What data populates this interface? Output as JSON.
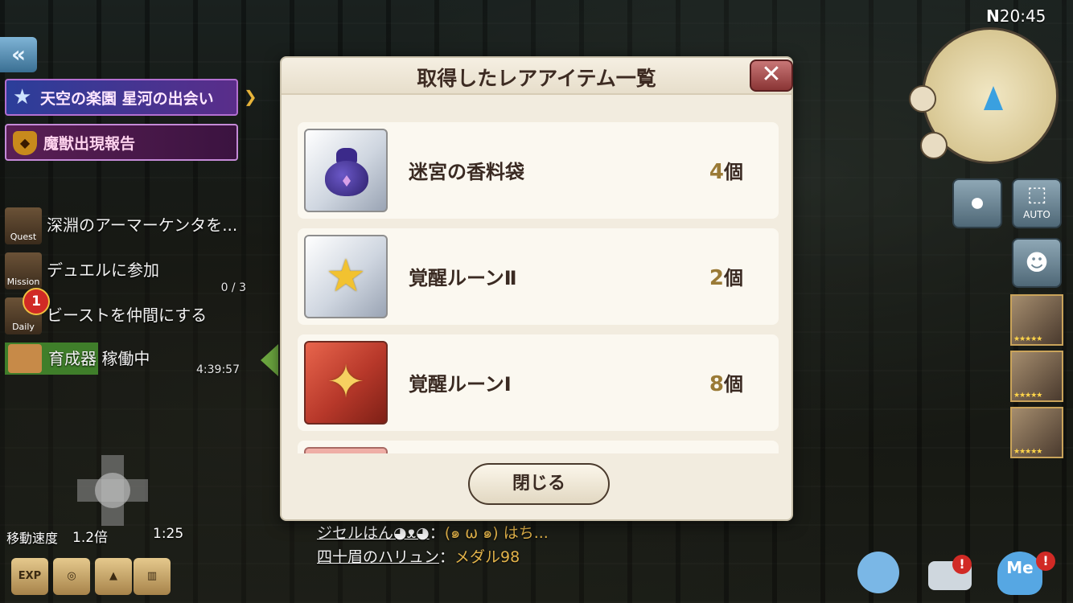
{
  "hud_left": {
    "back_icon": "double-chevron-left-icon",
    "event_banner": "天空の楽園 星河の出会い",
    "report_banner": "魔獣出現報告",
    "tasks": [
      {
        "tag": "Quest",
        "label": "深淵のアーマーケンタを...",
        "sub": ""
      },
      {
        "tag": "Mission",
        "label": "デュエルに参加",
        "sub": "0 / 3"
      },
      {
        "tag": "Daily",
        "label": "ビーストを仲間にする",
        "sub": ""
      }
    ],
    "daily_badge": "1",
    "raiser_label": "育成器",
    "raiser_status": "稼働中",
    "raiser_time": "4:39:57",
    "speed_label": "移動速度",
    "speed_value": "1.2倍",
    "speed_time": "1:25",
    "bottom_icons": [
      "EXP",
      "medal",
      "boot",
      "cage"
    ]
  },
  "hud_right": {
    "compass": "N",
    "clock": "20:45",
    "auto_label": "AUTO",
    "portrait_stars": "★★★★★"
  },
  "chat": [
    {
      "name": "ジセルはん◕ᴥ◕",
      "sep": "：",
      "msg": "(๑ ω ๑) はち..."
    },
    {
      "name": "四十眉のハリュン",
      "sep": "：",
      "msg": "メダル98"
    }
  ],
  "modal": {
    "title": "取得したレアアイテム一覧",
    "close_icon": "close-icon",
    "items": [
      {
        "name": "迷宮の香料袋",
        "qty": "4",
        "unit": "個",
        "icon": "pouch-icon"
      },
      {
        "name": "覚醒ルーンⅡ",
        "qty": "2",
        "unit": "個",
        "icon": "gold-star-icon"
      },
      {
        "name": "覚醒ルーンⅠ",
        "qty": "8",
        "unit": "個",
        "icon": "gold-star-icon"
      }
    ],
    "close_button": "閉じる"
  }
}
